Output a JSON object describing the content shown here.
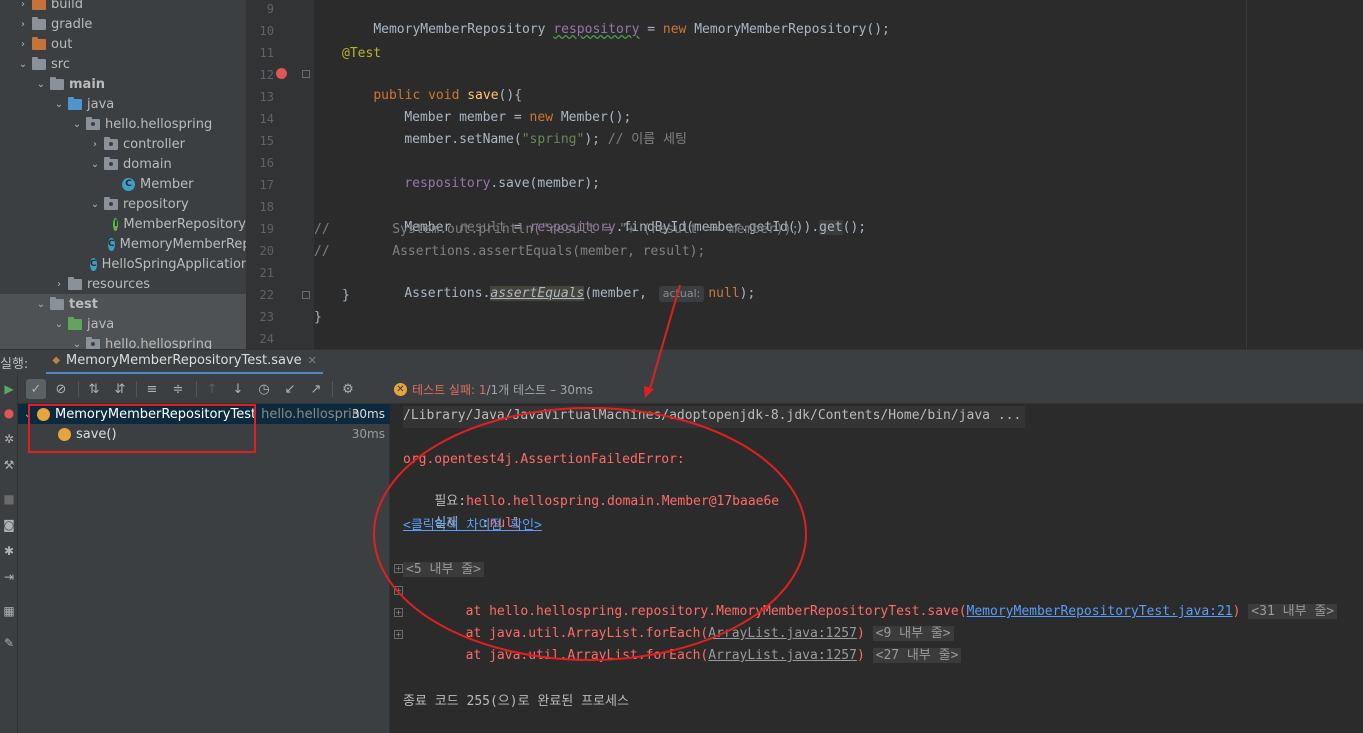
{
  "project_tree": [
    {
      "label": "build",
      "depth": 1,
      "kind": "folder-orange",
      "arrow": "›"
    },
    {
      "label": "gradle",
      "depth": 1,
      "kind": "folder",
      "arrow": "›"
    },
    {
      "label": "out",
      "depth": 1,
      "kind": "folder-orange",
      "arrow": "›"
    },
    {
      "label": "src",
      "depth": 1,
      "kind": "folder",
      "arrow": "⌄"
    },
    {
      "label": "main",
      "depth": 2,
      "kind": "folder",
      "arrow": "⌄",
      "bold": true
    },
    {
      "label": "java",
      "depth": 3,
      "kind": "folder-blue",
      "arrow": "⌄"
    },
    {
      "label": "hello.hellospring",
      "depth": 4,
      "kind": "package",
      "arrow": "⌄"
    },
    {
      "label": "controller",
      "depth": 5,
      "kind": "package",
      "arrow": "›"
    },
    {
      "label": "domain",
      "depth": 5,
      "kind": "package",
      "arrow": "⌄"
    },
    {
      "label": "Member",
      "depth": 6,
      "kind": "class"
    },
    {
      "label": "repository",
      "depth": 5,
      "kind": "package",
      "arrow": "⌄"
    },
    {
      "label": "MemberRepository",
      "depth": 6,
      "kind": "interface"
    },
    {
      "label": "MemoryMemberRepository",
      "depth": 6,
      "kind": "class"
    },
    {
      "label": "HelloSpringApplication",
      "depth": 5,
      "kind": "class"
    },
    {
      "label": "resources",
      "depth": 3,
      "kind": "folder",
      "arrow": "›"
    },
    {
      "label": "test",
      "depth": 2,
      "kind": "folder",
      "arrow": "⌄",
      "bold": true
    },
    {
      "label": "java",
      "depth": 3,
      "kind": "folder-green",
      "arrow": "⌄"
    },
    {
      "label": "hello.hellospring",
      "depth": 4,
      "kind": "package",
      "arrow": "⌄"
    }
  ],
  "editor": {
    "line_numbers": [
      "9",
      "10",
      "11",
      "12",
      "13",
      "14",
      "15",
      "16",
      "17",
      "18",
      "19",
      "20",
      "21",
      "22",
      "23",
      "24"
    ],
    "lines": {
      "l9_type": "MemoryMemberRepository ",
      "l9_field": "respository",
      "l9_eq": " = ",
      "l9_new": "new",
      "l9_rest": " MemoryMemberRepository();",
      "l11_ann": "@Test",
      "l12_kw": "public void ",
      "l12_name": "save",
      "l12_rest": "(){",
      "l13_a": "Member member = ",
      "l13_new": "new",
      "l13_b": " Member();",
      "l14_a": "member.setName(",
      "l14_str": "\"spring\"",
      "l14_b": "); ",
      "l14_cmt": "// 이름 세팅",
      "l16_field": "respository",
      "l16_rest": ".save(member);",
      "l18_a": "Member ",
      "l18_var": "result",
      "l18_eq": " = ",
      "l18_field": "respository",
      "l18_b": ".findById(member.getId()).",
      "l18_get": "get",
      "l18_c": "();",
      "l19_cmt": "//        System.out.println(\"result = \"+ (result == member));",
      "l20_cmt": "//        Assertions.assertEquals(member, result);",
      "l21_a": "Assertions.",
      "l21_m": "assertEquals",
      "l21_b": "(member, ",
      "l21_hint": "actual:",
      "l21_null": "null",
      "l21_c": ");",
      "l22": "}",
      "l23": "}"
    }
  },
  "run": {
    "label": "실행:",
    "tab_label": "MemoryMemberRepositoryTest.save",
    "status_fail": "테스트 실패: 1",
    "status_rest": " /1개 테스트 – 30ms",
    "tree": [
      {
        "name": "MemoryMemberRepositoryTest",
        "pkg": "hello.hellospring",
        "time": "30ms"
      },
      {
        "name": "save()",
        "time": "30ms"
      }
    ]
  },
  "console": {
    "cmd": "/Library/Java/JavaVirtualMachines/adoptopenjdk-8.jdk/Contents/Home/bin/java ...",
    "err": "org.opentest4j.AssertionFailedError:",
    "expected_label": "필요:",
    "expected_val": "hello.hellospring.domain.Member@17baae6e",
    "actual_label": "실제   :",
    "actual_val": "null",
    "diff_link": "<클릭하여 차이점 확인>",
    "fold1": "<5 내부 줄>",
    "at1_a": "    at hello.hellospring.repository.MemoryMemberRepositoryTest.save(",
    "at1_link": "MemoryMemberRepositoryTest.java:21",
    "at1_b": ")",
    "fold2": "<31 내부 줄>",
    "at2_a": "    at java.util.ArrayList.forEach(",
    "at2_link": "ArrayList.java:1257",
    "at2_b": ")",
    "fold3": "<9 내부 줄>",
    "at3_a": "    at java.util.ArrayList.forEach(",
    "at3_link": "ArrayList.java:1257",
    "at3_b": ")",
    "fold4": "<27 내부 줄>",
    "exit": "종료 코드 255(으)로 완료된 프로세스"
  },
  "colors": {
    "annotation": "#e02020"
  }
}
